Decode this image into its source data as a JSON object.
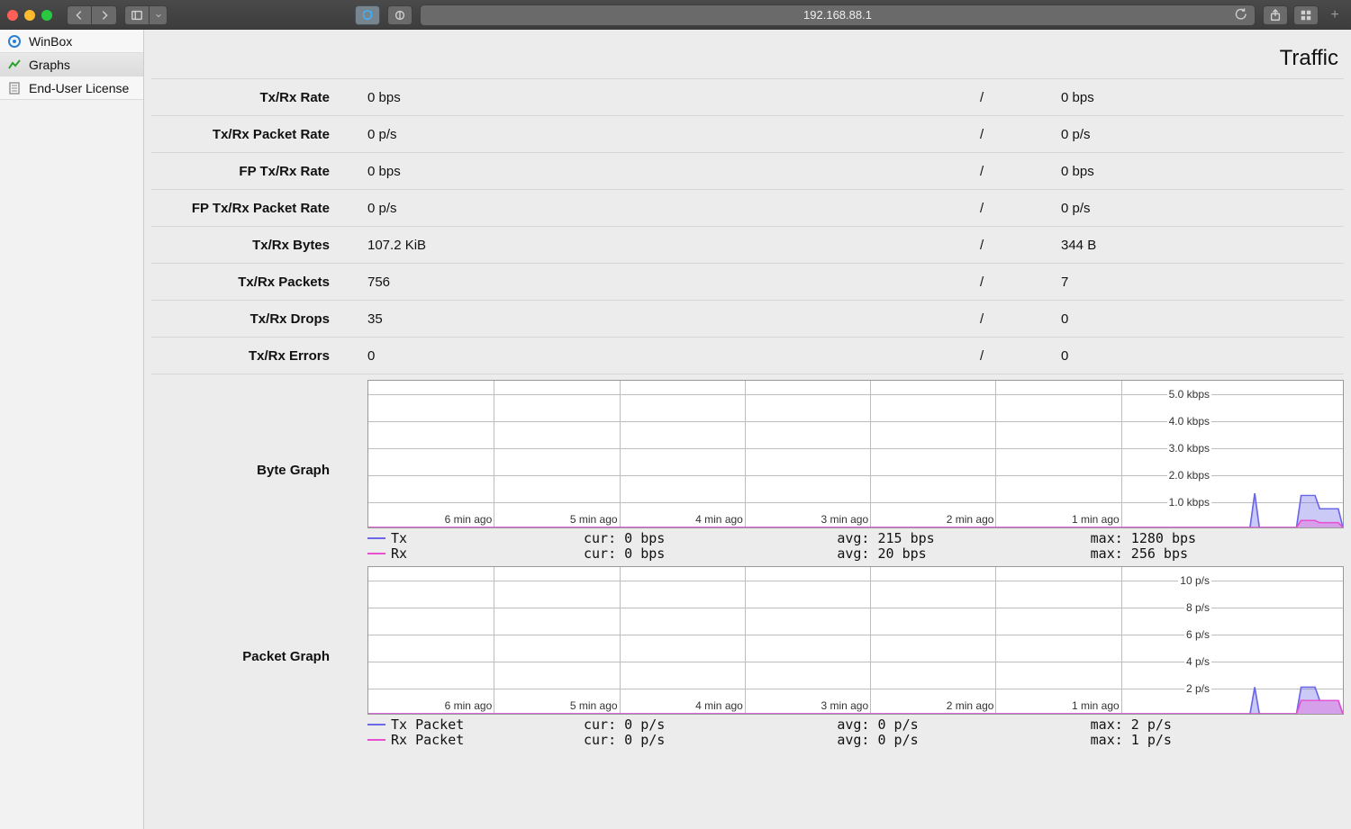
{
  "browser": {
    "url": "192.168.88.1"
  },
  "sidebar": {
    "items": [
      {
        "label": "WinBox",
        "selected": false,
        "icon": "winbox-icon"
      },
      {
        "label": "Graphs",
        "selected": true,
        "icon": "graph-icon"
      },
      {
        "label": "End-User License",
        "selected": false,
        "icon": "doc-icon"
      }
    ]
  },
  "page": {
    "title": "Traffic"
  },
  "stats": [
    {
      "label": "Tx/Rx Rate",
      "tx": "0 bps",
      "rx": "0 bps"
    },
    {
      "label": "Tx/Rx Packet Rate",
      "tx": "0 p/s",
      "rx": "0 p/s"
    },
    {
      "label": "FP Tx/Rx Rate",
      "tx": "0 bps",
      "rx": "0 bps"
    },
    {
      "label": "FP Tx/Rx Packet Rate",
      "tx": "0 p/s",
      "rx": "0 p/s"
    },
    {
      "label": "Tx/Rx Bytes",
      "tx": "107.2 KiB",
      "rx": "344 B"
    },
    {
      "label": "Tx/Rx Packets",
      "tx": "756",
      "rx": "7"
    },
    {
      "label": "Tx/Rx Drops",
      "tx": "35",
      "rx": "0"
    },
    {
      "label": "Tx/Rx Errors",
      "tx": "0",
      "rx": "0"
    }
  ],
  "graphs": {
    "byte": {
      "title": "Byte Graph",
      "legend": {
        "tx": {
          "name": "Tx",
          "cur": "cur: 0 bps",
          "avg": "avg: 215 bps",
          "max": "max: 1280 bps",
          "color": "#6b67e8"
        },
        "rx": {
          "name": "Rx",
          "cur": "cur: 0 bps",
          "avg": "avg: 20 bps",
          "max": "max: 256 bps",
          "color": "#e84fd1"
        }
      }
    },
    "packet": {
      "title": "Packet Graph",
      "legend": {
        "tx": {
          "name": "Tx Packet",
          "cur": "cur: 0 p/s",
          "avg": "avg: 0 p/s",
          "max": "max: 2 p/s",
          "color": "#6b67e8"
        },
        "rx": {
          "name": "Rx Packet",
          "cur": "cur: 0 p/s",
          "avg": "avg: 0 p/s",
          "max": "max: 1 p/s",
          "color": "#e84fd1"
        }
      }
    }
  },
  "chart_data": [
    {
      "type": "line",
      "title": "Byte Graph",
      "xlabel": "",
      "ylabel": "",
      "x_ticks": [
        "6 min ago",
        "5 min ago",
        "4 min ago",
        "3 min ago",
        "2 min ago",
        "1 min ago"
      ],
      "y_ticks": [
        "1.0 kbps",
        "2.0 kbps",
        "3.0 kbps",
        "4.0 kbps",
        "5.0 kbps"
      ],
      "ylim": [
        0,
        5.5
      ],
      "xlim_seconds": [
        -420,
        0
      ],
      "series": [
        {
          "name": "Tx",
          "color": "#6b67e8",
          "x": [
            -420,
            -40,
            -38,
            -36,
            -20,
            -18,
            -12,
            -10,
            -2,
            0
          ],
          "y": [
            0,
            0,
            1.28,
            0,
            0,
            1.2,
            1.2,
            0.7,
            0.7,
            0
          ]
        },
        {
          "name": "Rx",
          "color": "#e84fd1",
          "x": [
            -420,
            -20,
            -18,
            -12,
            -10,
            -2,
            0
          ],
          "y": [
            0,
            0,
            0.26,
            0.26,
            0.18,
            0.18,
            0
          ]
        }
      ],
      "cur": {
        "Tx": "0 bps",
        "Rx": "0 bps"
      },
      "avg": {
        "Tx": "215 bps",
        "Rx": "20 bps"
      },
      "max": {
        "Tx": "1280 bps",
        "Rx": "256 bps"
      }
    },
    {
      "type": "line",
      "title": "Packet Graph",
      "xlabel": "",
      "ylabel": "",
      "x_ticks": [
        "6 min ago",
        "5 min ago",
        "4 min ago",
        "3 min ago",
        "2 min ago",
        "1 min ago"
      ],
      "y_ticks": [
        "2 p/s",
        "4 p/s",
        "6 p/s",
        "8 p/s",
        "10 p/s"
      ],
      "ylim": [
        0,
        11
      ],
      "xlim_seconds": [
        -420,
        0
      ],
      "series": [
        {
          "name": "Tx Packet",
          "color": "#6b67e8",
          "x": [
            -420,
            -40,
            -38,
            -36,
            -20,
            -18,
            -12,
            -10,
            -2,
            0
          ],
          "y": [
            0,
            0,
            2,
            0,
            0,
            2,
            2,
            1,
            1,
            0
          ]
        },
        {
          "name": "Rx Packet",
          "color": "#e84fd1",
          "x": [
            -420,
            -20,
            -18,
            -12,
            -10,
            -2,
            0
          ],
          "y": [
            0,
            0,
            1,
            1,
            1,
            1,
            0
          ]
        }
      ],
      "cur": {
        "Tx Packet": "0 p/s",
        "Rx Packet": "0 p/s"
      },
      "avg": {
        "Tx Packet": "0 p/s",
        "Rx Packet": "0 p/s"
      },
      "max": {
        "Tx Packet": "2 p/s",
        "Rx Packet": "1 p/s"
      }
    }
  ]
}
